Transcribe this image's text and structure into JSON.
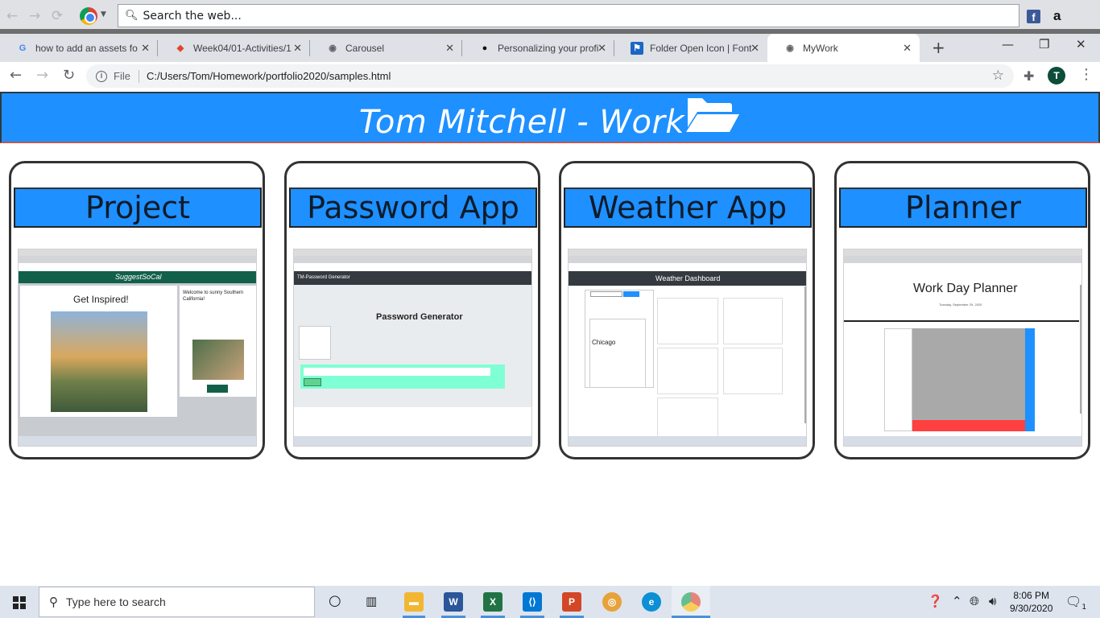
{
  "outer_browser": {
    "search_placeholder": "Search the web..."
  },
  "tabs": [
    {
      "icon": "G",
      "title": "how to add an assets fo",
      "color": "#4285f4"
    },
    {
      "icon": "◆",
      "title": "Week04/01-Activities/1",
      "color": "#e2432a"
    },
    {
      "icon": "◉",
      "title": "Carousel",
      "color": "#5f6368"
    },
    {
      "icon": "●",
      "title": "Personalizing your profi",
      "color": "#111"
    },
    {
      "icon": "⚑",
      "title": "Folder Open Icon | Font",
      "color": "#1c66c4"
    },
    {
      "icon": "◉",
      "title": "MyWork",
      "color": "#5f6368",
      "active": true
    }
  ],
  "address": {
    "prefix": "File",
    "url": "C:/Users/Tom/Homework/portfolio2020/samples.html"
  },
  "profile": {
    "initial": "T"
  },
  "site": {
    "title": "Tom Mitchell - Work"
  },
  "cards": [
    {
      "title": "Project",
      "shot_caption": "Get Inspired!",
      "shot_sub": "Welcome to sunny Southern California!",
      "brand": "SuggestSoCal"
    },
    {
      "title": "Password App",
      "shot_caption": "Password Generator",
      "shot_sub": "TM-Password Generator"
    },
    {
      "title": "Weather App",
      "shot_caption": "Weather Dashboard",
      "shot_sub": "Chicago"
    },
    {
      "title": "Planner",
      "shot_caption": "Work Day Planner",
      "shot_sub": "Tuesday, September 29, 2020"
    }
  ],
  "taskbar": {
    "search_placeholder": "Type here to search",
    "time": "8:06 PM",
    "date": "9/30/2020",
    "notification_count": "1"
  },
  "colors": {
    "header_blue": "#1e90ff",
    "card_border": "#333333"
  }
}
